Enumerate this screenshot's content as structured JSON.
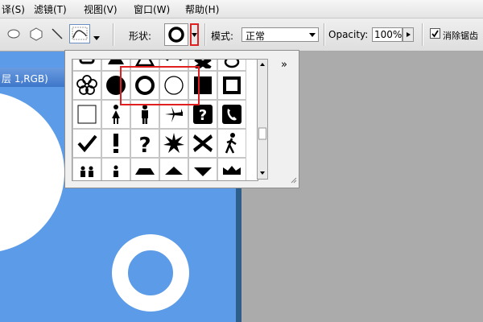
{
  "menu": {
    "items": [
      "译(S)",
      "滤镜(T)",
      "视图(V)",
      "窗口(W)",
      "帮助(H)"
    ]
  },
  "options": {
    "shape_label": "形状:",
    "mode_label": "模式:",
    "mode_value": "正常",
    "opacity_label": "Opacity:",
    "opacity_value": "100%",
    "antialias_label": "消除锯齿",
    "antialias_checked": true
  },
  "document": {
    "tab_title": "层 1,RGB)"
  },
  "shape_picker": {
    "expand_icon": "»",
    "selected_shape": "ring-thick",
    "highlighted_shapes": [
      "circle-filled",
      "ring-thick",
      "ring-thin"
    ],
    "shapes": [
      [
        "square-outline",
        "blob",
        "triangle",
        "blob",
        "cross-bold",
        "blob"
      ],
      [
        "flower-outline",
        "circle-filled",
        "ring-thick",
        "ring-thin",
        "square-filled",
        "square-frame"
      ],
      [
        "square-thin",
        "person-female",
        "person-male",
        "airplane",
        "question-box",
        "phone-box"
      ],
      [
        "checkmark",
        "exclamation",
        "question",
        "starburst",
        "x-bold",
        "walker"
      ],
      [
        "people",
        "person-small",
        "hexagon",
        "triangle",
        "triangle-down",
        "crown"
      ]
    ]
  },
  "colors": {
    "canvas_blue": "#5b9be8",
    "workspace_gray": "#ababab",
    "highlight_red": "#e02020"
  }
}
